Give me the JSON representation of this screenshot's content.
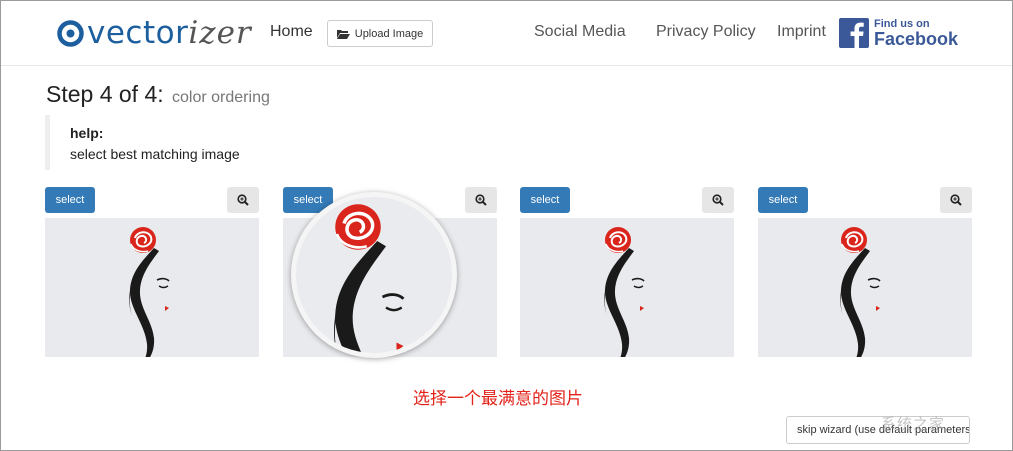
{
  "header": {
    "logo": {
      "text_main": "vectorizer",
      "text_prefix": "vector",
      "text_suffix": "izer",
      "icon": "target-icon"
    },
    "nav": {
      "home": "Home",
      "upload": "Upload Image",
      "upload_icon": "folder-open-icon",
      "social": "Social Media",
      "privacy": "Privacy Policy",
      "imprint": "Imprint"
    },
    "facebook": {
      "small": "Find us on",
      "big": "Facebook",
      "icon": "facebook-icon",
      "color": "#3b5998"
    }
  },
  "step": {
    "title": "Step 4 of 4:",
    "subtitle": "color ordering"
  },
  "help": {
    "label": "help:",
    "text": "select best matching image"
  },
  "options": [
    {
      "select_label": "select",
      "zoom_icon": "zoom-in-icon"
    },
    {
      "select_label": "select",
      "zoom_icon": "zoom-in-icon"
    },
    {
      "select_label": "select",
      "zoom_icon": "zoom-in-icon"
    },
    {
      "select_label": "select",
      "zoom_icon": "zoom-in-icon"
    }
  ],
  "annotation": "选择一个最满意的图片",
  "skip": {
    "label": "skip wizard (use default parameters)"
  },
  "watermark": "系统之家",
  "colors": {
    "primary": "#337ab7",
    "brand": "#1d5f9e",
    "annotation": "#e2231a",
    "preview_bg": "#e8eaed"
  }
}
